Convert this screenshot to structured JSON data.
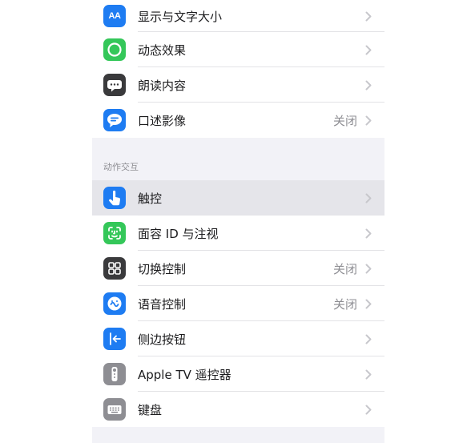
{
  "groups": [
    {
      "items": [
        {
          "label": "显示与文字大小",
          "icon": "text-size-icon",
          "icon_text": "AA",
          "icon_color": "#1e7cf2"
        },
        {
          "label": "动态效果",
          "icon": "motion-icon",
          "icon_color": "#34c759"
        },
        {
          "label": "朗读内容",
          "icon": "spoken-content-icon",
          "icon_color": "#3a3a3c"
        },
        {
          "label": "口述影像",
          "value": "关闭",
          "icon": "audio-descriptions-icon",
          "icon_color": "#1e7cf2"
        }
      ]
    },
    {
      "header": "动作交互",
      "items": [
        {
          "label": "触控",
          "icon": "touch-icon",
          "icon_color": "#1e7cf2",
          "selected": true
        },
        {
          "label": "面容 ID 与注视",
          "icon": "face-id-icon",
          "icon_color": "#34c759"
        },
        {
          "label": "切换控制",
          "value": "关闭",
          "icon": "switch-control-icon",
          "icon_color": "#3a3a3c"
        },
        {
          "label": "语音控制",
          "value": "关闭",
          "icon": "voice-control-icon",
          "icon_color": "#1e7cf2"
        },
        {
          "label": "侧边按钮",
          "icon": "side-button-icon",
          "icon_color": "#1e7cf2"
        },
        {
          "label": "Apple TV 遥控器",
          "icon": "apple-tv-remote-icon",
          "icon_color": "#8e8e93"
        },
        {
          "label": "键盘",
          "icon": "keyboard-icon",
          "icon_color": "#8e8e93"
        }
      ]
    }
  ],
  "colors": {
    "group_background": "#f2f2f7",
    "row_background": "#ffffff",
    "highlight": "#e5e5ea",
    "secondary_text": "#8e8e93",
    "separator": "#e3e3e6"
  }
}
